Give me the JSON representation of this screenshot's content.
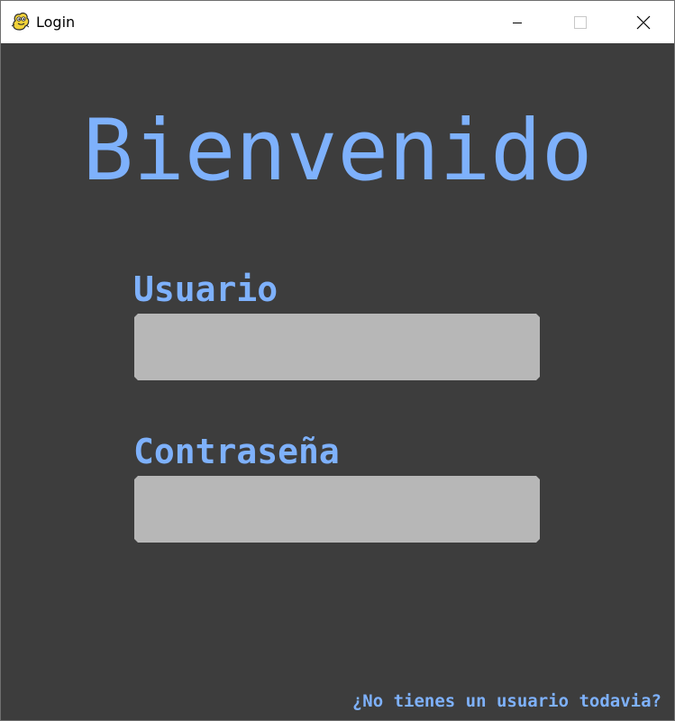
{
  "window": {
    "title": "Login",
    "icon": "pygame-snake-icon",
    "controls": [
      "minimize-icon",
      "maximize-icon",
      "close-icon"
    ]
  },
  "login": {
    "welcome": "Bienvenido",
    "user_label": "Usuario",
    "user_value": "",
    "password_label": "Contraseña",
    "password_value": "",
    "register_link": "¿No tienes un usuario todavia?"
  },
  "colors": {
    "background": "#3d3d3d",
    "accent": "#7eb1fc",
    "input_fill": "#b7b7b7",
    "titlebar": "#ffffff"
  }
}
